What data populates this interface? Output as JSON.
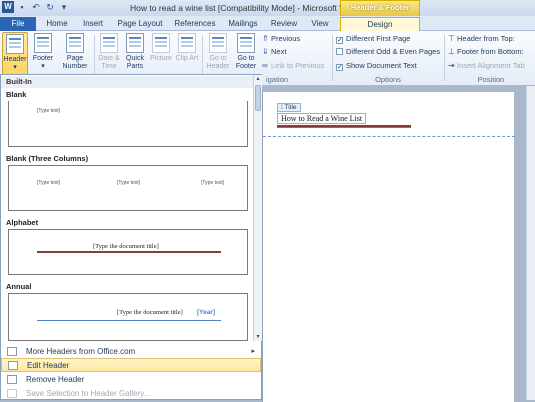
{
  "window": {
    "title": "How to read a wine list [Compatibility Mode] - Microsoft Word",
    "context_tab_title": "Header & Footer Tools"
  },
  "tabs": [
    "File",
    "Home",
    "Insert",
    "Page Layout",
    "References",
    "Mailings",
    "Review",
    "View",
    "Design"
  ],
  "ribbon": {
    "header_footer": {
      "header": "Header",
      "footer": "Footer",
      "page_number": "Page Number"
    },
    "insert": {
      "date_time": "Date & Time",
      "quick_parts": "Quick Parts",
      "picture": "Picture",
      "clip_art": "Clip Art"
    },
    "navigation": {
      "go_to_header": "Go to Header",
      "go_to_footer": "Go to Footer",
      "previous": "Previous",
      "next": "Next",
      "link_to_previous": "Link to Previous",
      "label": "igation"
    },
    "options": {
      "different_first_page": "Different First Page",
      "different_odd_even": "Different Odd & Even Pages",
      "show_document_text": "Show Document Text",
      "label": "Options"
    },
    "position": {
      "header_from_top": "Header from Top:",
      "footer_from_bottom": "Footer from Bottom:",
      "insert_alignment_tab": "Insert Alignment Tab",
      "label": "Position"
    }
  },
  "gallery": {
    "section": "Built-In",
    "items": [
      {
        "name": "Blank",
        "placeholder": "[Type text]"
      },
      {
        "name": "Blank (Three Columns)",
        "placeholder": "[Type text]"
      },
      {
        "name": "Alphabet",
        "placeholder": "[Type the document title]"
      },
      {
        "name": "Annual",
        "placeholder": "[Type the document title]",
        "year": "[Year]"
      }
    ],
    "menu": {
      "more_headers": "More Headers from Office.com",
      "edit_header": "Edit Header",
      "remove_header": "Remove Header",
      "save_selection": "Save Selection to Header Gallery..."
    }
  },
  "document": {
    "field_tag": "Title",
    "title": "How to Read a Wine List"
  }
}
